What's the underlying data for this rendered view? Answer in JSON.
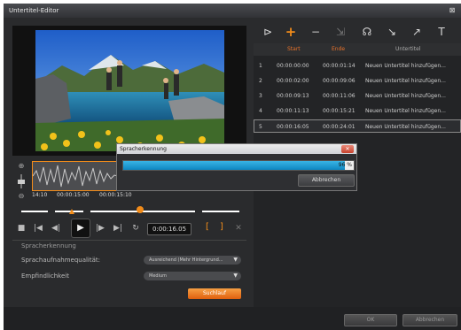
{
  "window": {
    "title": "Untertitel-Editor"
  },
  "toolbar": {
    "icons": [
      "import-icon",
      "add-icon",
      "remove-icon",
      "merge-icon",
      "voice-recognition-icon",
      "import-file-icon",
      "export-icon",
      "text-edit-icon"
    ]
  },
  "table": {
    "headers": {
      "start": "Start",
      "end": "Ende",
      "subtitle": "Untertitel"
    },
    "rows": [
      {
        "num": "1",
        "start": "00:00:00:00",
        "end": "00:00:01:14",
        "text": "Neuen Untertitel hinzufügen..."
      },
      {
        "num": "2",
        "start": "00:00:02:00",
        "end": "00:00:09:06",
        "text": "Neuen Untertitel hinzufügen..."
      },
      {
        "num": "3",
        "start": "00:00:09:13",
        "end": "00:00:11:06",
        "text": "Neuen Untertitel hinzufügen..."
      },
      {
        "num": "4",
        "start": "00:00:11:13",
        "end": "00:00:15:21",
        "text": "Neuen Untertitel hinzufügen..."
      },
      {
        "num": "5",
        "start": "00:00:16:05",
        "end": "00:00:24:01",
        "text": "Neuen Untertitel hinzufügen..."
      }
    ],
    "selected_row": 5
  },
  "timeline": {
    "ticks": [
      "14:10",
      "00:00:15:00",
      "00:00:15:10"
    ]
  },
  "transport": {
    "timecode": "0:00:16.05"
  },
  "panel": {
    "heading": "Spracherkennung",
    "quality_label": "Sprachaufnahmequalität:",
    "quality_value": "Ausreichend (Mehr Hintergrund...",
    "sensitivity_label": "Empfindlichkeit",
    "sensitivity_value": "Medium",
    "search_button": "Suchlauf"
  },
  "dialog": {
    "title": "Spracherkennung",
    "progress_percent": 96,
    "progress_label": "96 %",
    "cancel": "Abbrechen"
  },
  "footer": {
    "ok": "OK",
    "cancel": "Abbrechen"
  },
  "colors": {
    "accent": "#f28c1a",
    "progress": "#1a9bd4",
    "header_orange": "#e8722a"
  }
}
